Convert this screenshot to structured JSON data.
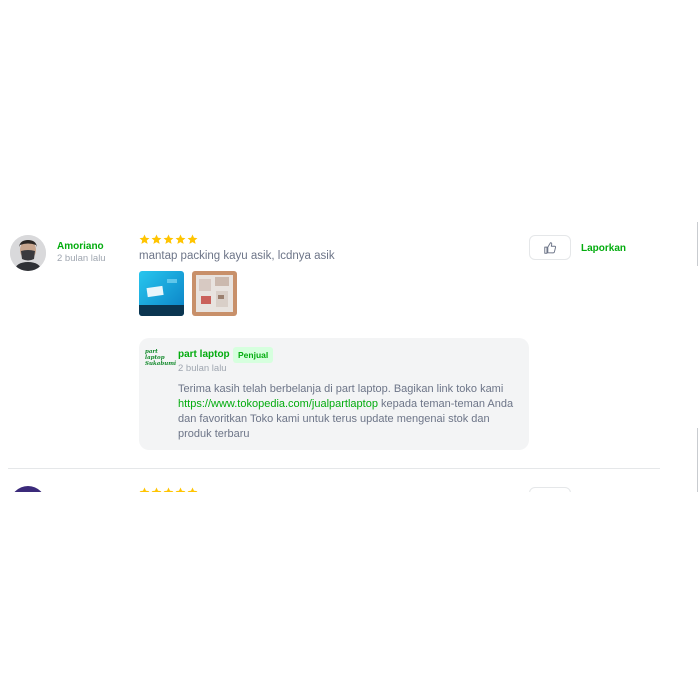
{
  "review": {
    "reviewer_name": "Amoriano",
    "time": "2 bulan lalu",
    "rating": 5,
    "text": "mantap packing kayu asik, lcdnya asik",
    "report_label": "Laporkan",
    "star_color": "#ffc400",
    "accent_color": "#03ac0e"
  },
  "reply": {
    "seller_name": "part laptop",
    "seller_logo_text": "part laptop Sukabumi",
    "badge": "Penjual",
    "time": "2 bulan lalu",
    "text_before": "Terima kasih telah berbelanja di part laptop. Bagikan link toko kami ",
    "link": "https://www.tokopedia.com/jualpartlaptop",
    "text_after": " kepada teman-teman Anda dan favoritkan Toko kami untuk terus update mengenai stok dan produk terbaru"
  },
  "icons": {
    "like": "thumbs-up-icon",
    "star": "star-icon"
  }
}
